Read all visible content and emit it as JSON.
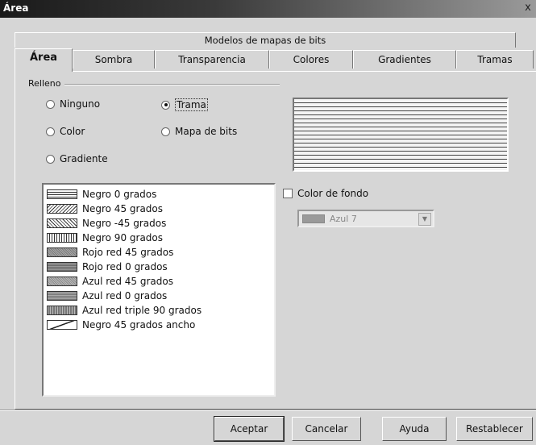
{
  "window": {
    "title": "Área",
    "close_label": "x"
  },
  "tabs_top": [
    "Modelos de mapas de bits"
  ],
  "tabs": [
    {
      "label": "Área",
      "active": true
    },
    {
      "label": "Sombra",
      "active": false
    },
    {
      "label": "Transparencia",
      "active": false
    },
    {
      "label": "Colores",
      "active": false
    },
    {
      "label": "Gradientes",
      "active": false
    },
    {
      "label": "Tramas",
      "active": false
    }
  ],
  "fill_group": {
    "label": "Relleno",
    "options": [
      {
        "label": "Ninguno",
        "selected": false
      },
      {
        "label": "Color",
        "selected": false
      },
      {
        "label": "Gradiente",
        "selected": false
      },
      {
        "label": "Trama",
        "selected": true
      },
      {
        "label": "Mapa de bits",
        "selected": false
      }
    ]
  },
  "hatch_list": [
    {
      "label": "Negro 0 grados",
      "swatch": "black-0"
    },
    {
      "label": "Negro 45 grados",
      "swatch": "black-45"
    },
    {
      "label": "Negro -45 grados",
      "swatch": "black-neg45"
    },
    {
      "label": "Negro 90 grados",
      "swatch": "black-90"
    },
    {
      "label": "Rojo red 45 grados",
      "swatch": "red-net-45"
    },
    {
      "label": "Rojo red 0 grados",
      "swatch": "red-net-0"
    },
    {
      "label": "Azul red 45 grados",
      "swatch": "blue-net-45"
    },
    {
      "label": "Azul red 0 grados",
      "swatch": "blue-net-0"
    },
    {
      "label": "Azul red triple 90 grados",
      "swatch": "blue-triple-90"
    },
    {
      "label": "Negro 45 grados ancho",
      "swatch": "black-45-wide"
    }
  ],
  "background_color": {
    "label": "Color de fondo",
    "checked": false,
    "select_value": "Azul 7",
    "enabled": false
  },
  "buttons": {
    "ok": "Aceptar",
    "cancel": "Cancelar",
    "help": "Ayuda",
    "reset": "Restablecer"
  }
}
